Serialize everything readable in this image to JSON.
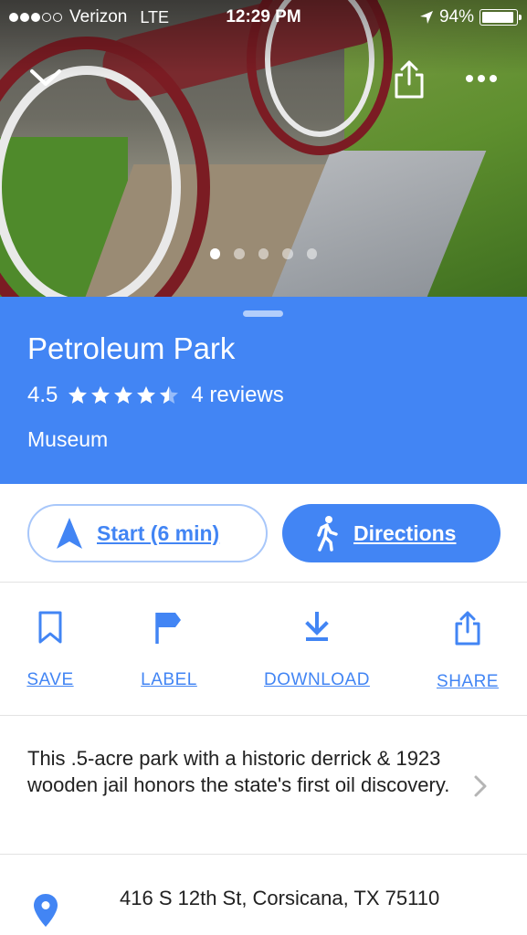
{
  "status_bar": {
    "carrier": "Verizon",
    "network": "LTE",
    "time": "12:29 PM",
    "battery": "94%",
    "signal_bars_filled": 3,
    "signal_bars_total": 5
  },
  "hero": {
    "photo_count": 5,
    "active_photo_index": 0
  },
  "place": {
    "name": "Petroleum Park",
    "rating": "4.5",
    "reviews": "4 reviews",
    "category": "Museum"
  },
  "pills": {
    "start_label": "Start (6 min)",
    "directions_label": "Directions"
  },
  "actions": {
    "save_label": "SAVE",
    "label_label": "LABEL",
    "download_label": "DOWNLOAD",
    "share_label": "SHARE"
  },
  "description": "This .5-acre park with a historic derrick & 1923 wooden jail honors the state's first oil discovery.",
  "address": "416 S 12th St, Corsicana, TX 75110",
  "colors": {
    "accent": "#4285f4",
    "header_bg": "#4285f4",
    "divider": "#e3e3e3",
    "text": "#212121"
  },
  "icons": [
    "collapse-chevron-icon",
    "share-icon",
    "more-icon",
    "star-icon",
    "navigation-arrow-icon",
    "walking-icon",
    "bookmark-icon",
    "flag-icon",
    "download-icon",
    "chevron-right-icon",
    "location-pin-icon"
  ]
}
